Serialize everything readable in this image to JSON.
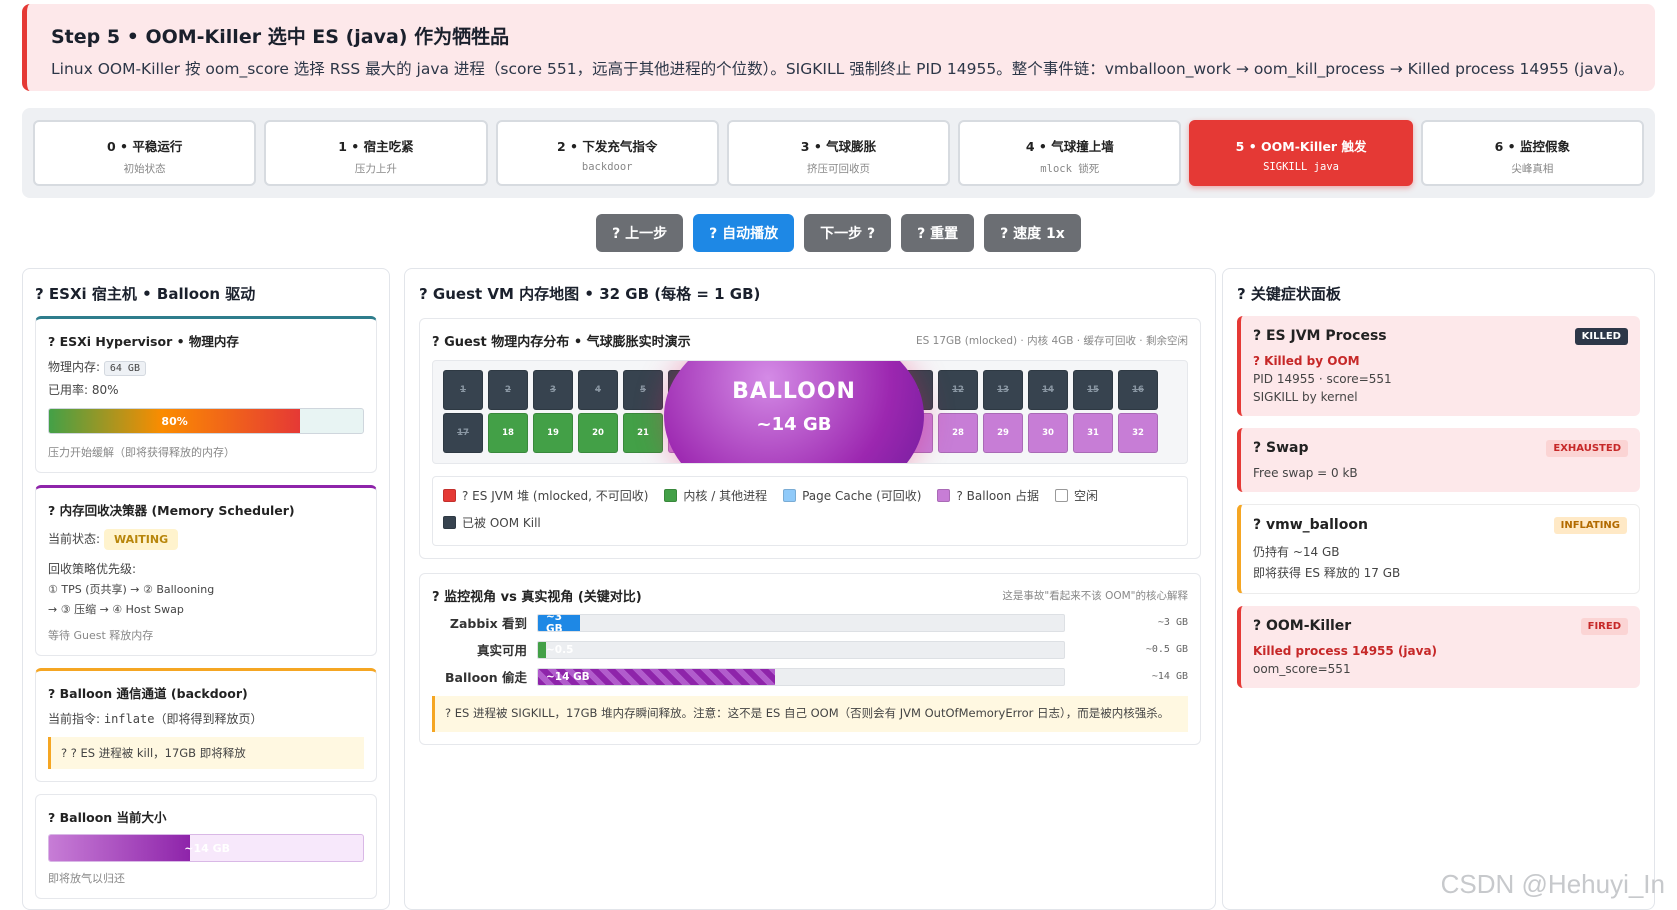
{
  "banner": {
    "title": "Step 5 • OOM-Killer 选中 ES (java) 作为牺牲品",
    "desc": "Linux OOM-Killer 按 oom_score 选择 RSS 最大的 java 进程（score 551，远高于其他进程的个位数）。SIGKILL 强制终止 PID 14955。整个事件链：vmballoon_work → oom_kill_process → Killed process 14955 (java)。"
  },
  "steps": [
    {
      "title": "0 • 平稳运行",
      "sub": "初始状态"
    },
    {
      "title": "1 • 宿主吃紧",
      "sub": "压力上升"
    },
    {
      "title": "2 • 下发充气指令",
      "sub": "backdoor"
    },
    {
      "title": "3 • 气球膨胀",
      "sub": "挤压可回收页"
    },
    {
      "title": "4 • 气球撞上墙",
      "sub": "mlock 锁死"
    },
    {
      "title": "5 • OOM-Killer 触发",
      "sub": "SIGKILL java"
    },
    {
      "title": "6 • 监控假象",
      "sub": "尖峰真相"
    }
  ],
  "controls": {
    "prev": "? 上一步",
    "auto": "? 自动播放",
    "next": "下一步 ?",
    "reset": "? 重置",
    "speed": "? 速度 1x"
  },
  "left": {
    "title": "? ESXi 宿主机 • Balloon 驱动",
    "hv": {
      "title": "? ESXi Hypervisor • 物理内存",
      "mem_label": "物理内存:",
      "mem_value": "64 GB",
      "used": "已用率: 80%",
      "bar_label": "80%",
      "bar_pct": 80,
      "note": "压力开始缓解（即将获得释放的内存）"
    },
    "sched": {
      "title": "? 内存回收决策器 (Memory Scheduler)",
      "state_label": "当前状态:",
      "state": "WAITING",
      "priority_title": "回收策略优先级:",
      "p1": "① TPS (页共享) → ② Ballooning",
      "p2": "→ ③ 压缩 → ④ Host Swap",
      "note": "等待 Guest 释放内存"
    },
    "chan": {
      "title": "? Balloon 通信通道 (backdoor)",
      "cmd_prefix": "当前指令: ",
      "cmd": "inflate",
      "cmd_suffix": "（即将得到释放页）",
      "note": "? ? ES 进程被 kill，17GB 即将释放"
    },
    "size": {
      "title": "? Balloon 当前大小",
      "label": "~14 GB",
      "pct": 45,
      "note": "即将放气以归还"
    }
  },
  "mid": {
    "title": "? Guest VM 内存地图 • 32 GB (每格 = 1 GB)",
    "map": {
      "title": "? Guest 物理内存分布 • 气球膨胀实时演示",
      "summary": "ES 17GB (mlocked) · 内核 4GB · 缓存可回收 · 剩余空闲",
      "balloon_name": "BALLOON",
      "balloon_size": "~14 GB",
      "cells": [
        {
          "n": "1",
          "k": "killed"
        },
        {
          "n": "2",
          "k": "killed"
        },
        {
          "n": "3",
          "k": "killed"
        },
        {
          "n": "4",
          "k": "killed"
        },
        {
          "n": "5",
          "k": "killed"
        },
        {
          "n": "6",
          "k": "killed"
        },
        {
          "n": "7",
          "k": "killed"
        },
        {
          "n": "8",
          "k": "killed"
        },
        {
          "n": "9",
          "k": "killed"
        },
        {
          "n": "10",
          "k": "killed"
        },
        {
          "n": "11",
          "k": "killed"
        },
        {
          "n": "12",
          "k": "killed"
        },
        {
          "n": "13",
          "k": "killed"
        },
        {
          "n": "14",
          "k": "killed"
        },
        {
          "n": "15",
          "k": "killed"
        },
        {
          "n": "16",
          "k": "killed"
        },
        {
          "n": "17",
          "k": "killed"
        },
        {
          "n": "18",
          "k": "kernel"
        },
        {
          "n": "19",
          "k": "kernel"
        },
        {
          "n": "20",
          "k": "kernel"
        },
        {
          "n": "21",
          "k": "kernel"
        },
        {
          "n": "22",
          "k": "balloon"
        },
        {
          "n": "23",
          "k": "balloon"
        },
        {
          "n": "24",
          "k": "balloon"
        },
        {
          "n": "25",
          "k": "balloon"
        },
        {
          "n": "26",
          "k": "balloon"
        },
        {
          "n": "27",
          "k": "balloon"
        },
        {
          "n": "28",
          "k": "balloon"
        },
        {
          "n": "29",
          "k": "balloon"
        },
        {
          "n": "30",
          "k": "balloon"
        },
        {
          "n": "31",
          "k": "balloon"
        },
        {
          "n": "32",
          "k": "balloon"
        }
      ],
      "legend": [
        {
          "label": "? ES JVM 堆 (mlocked, 不可回收)",
          "color": "#e53935"
        },
        {
          "label": "内核 / 其他进程",
          "color": "#43a047"
        },
        {
          "label": "Page Cache (可回收)",
          "color": "#90caf9"
        },
        {
          "label": "? Balloon 占据",
          "color": "#c77dd6"
        },
        {
          "label": "空闲",
          "color": "#ffffff"
        },
        {
          "label": "已被 OOM Kill",
          "color": "#37434f"
        }
      ]
    },
    "views": {
      "title": "? 监控视角 vs 真实视角 (关键对比)",
      "hint": "这是事故\"看起来不该 OOM\"的核心解释",
      "rows": [
        {
          "label": "Zabbix 看到",
          "bar": "~3 GB",
          "value": "~3 GB",
          "pct": 8,
          "color": "#1e88e5"
        },
        {
          "label": "真实可用",
          "bar": "~0.5",
          "value": "~0.5 GB",
          "pct": 1.5,
          "color": "#43a047"
        },
        {
          "label": "Balloon 偷走",
          "bar": "~14 GB",
          "value": "~14 GB",
          "pct": 45,
          "color": "stripe"
        }
      ],
      "note": "? ES 进程被 SIGKILL，17GB 堆内存瞬间释放。注意：这不是 ES 自己 OOM（否则会有 JVM OutOfMemoryError 日志），而是被内核强杀。"
    }
  },
  "right": {
    "title": "? 关键症状面板",
    "cards": [
      {
        "title": "? ES JVM Process",
        "badge": "KILLED",
        "badge_style": "dark",
        "style": "red",
        "l1": "? Killed by OOM",
        "l1_red": true,
        "l2": "PID 14955 · score=551",
        "l3": "SIGKILL by kernel"
      },
      {
        "title": "? Swap",
        "badge": "EXHAUSTED",
        "badge_style": "red",
        "style": "red",
        "l1": "Free swap = 0 kB",
        "l1_red": false,
        "l2": "",
        "l3": ""
      },
      {
        "title": "? vmw_balloon",
        "badge": "INFLATING",
        "badge_style": "orange",
        "style": "warn",
        "l1": "仍持有 ~14 GB",
        "l1_red": false,
        "l2": "即将获得 ES 释放的 17 GB",
        "l3": ""
      },
      {
        "title": "? OOM-Killer",
        "badge": "FIRED",
        "badge_style": "red",
        "style": "red",
        "l1": "Killed process 14955 (java)",
        "l1_red": true,
        "l2": "oom_score=551",
        "l3": ""
      }
    ]
  },
  "watermark": "CSDN @Hehuyi_In",
  "colors": {
    "danger": "#e53935",
    "primary": "#1e88e5",
    "balloon": "#8e24aa",
    "kernel": "#43a047"
  }
}
